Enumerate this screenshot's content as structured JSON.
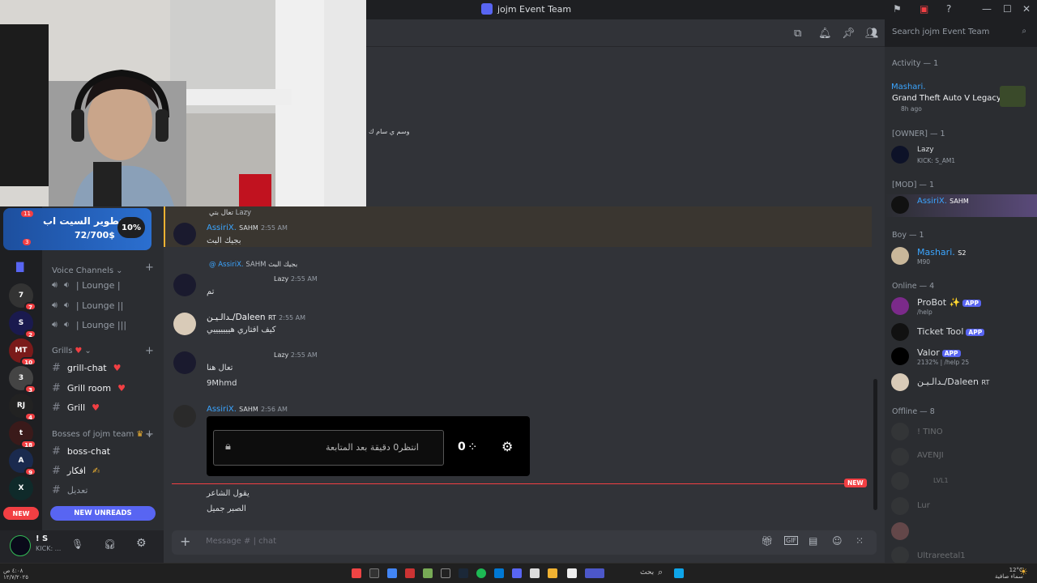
{
  "window": {
    "title": "jojm Event Team",
    "min": "—",
    "max": "☐",
    "close": "✕"
  },
  "banner": {
    "title": "تطوير السيت اب",
    "amount": "72/700$",
    "percent": "10%",
    "count": "11",
    "count2": "3"
  },
  "categories": [
    {
      "label": "Voice Channels",
      "channels": [
        "| Lounge |",
        "| Lounge ||",
        "| Lounge |||"
      ]
    },
    {
      "label": "Grills",
      "channels": [
        "grill-chat",
        "Grill room",
        "Grill"
      ]
    },
    {
      "label": "Bosses of jojm team",
      "channels": [
        "boss-chat",
        "افكار",
        "تعديل"
      ]
    }
  ],
  "servers": [
    {
      "abbr": "7",
      "badge": "7"
    },
    {
      "abbr": "S",
      "badge": "2"
    },
    {
      "abbr": "MT",
      "badge": "10"
    },
    {
      "abbr": "3",
      "badge": "3"
    },
    {
      "abbr": "RJ",
      "badge": "4"
    },
    {
      "abbr": "t",
      "badge": "18"
    },
    {
      "abbr": "A",
      "badge": "9"
    },
    {
      "abbr": "X",
      "badge": ""
    }
  ],
  "new_unreads": "NEW UNREADS",
  "new_pill": "NEW",
  "user": {
    "name": "! S",
    "status": "KICK: ..."
  },
  "search": {
    "placeholder": "Search jojm Event Team"
  },
  "overlay_text": "وسم ي سام ك",
  "messages": [
    {
      "reply": "تعال بتي",
      "reply_tag": "Lazy",
      "author": "AssiriX.",
      "tag": "SAHM",
      "time": "2:55 AM",
      "text": "بجيك البث"
    },
    {
      "reply": "بجيك البث",
      "reply_user": "@ AssiriX.",
      "reply_tag": "SAHM",
      "tag": "Lazy",
      "time": "2:55 AM",
      "text": "تم"
    },
    {
      "author": "ـدالـيـن/Daleen",
      "tag": "RT",
      "time": "2:55 AM",
      "text": "كيف افتاري هيييييييي"
    },
    {
      "tag": "Lazy",
      "time": "2:55 AM",
      "text": "تعال هنا",
      "text2": "9Mhmd"
    },
    {
      "author": "AssiriX.",
      "tag": "SAHM",
      "time": "2:56 AM"
    },
    {
      "text": "يقول الشاعر",
      "text2": "الصبر جميل"
    }
  ],
  "embed": {
    "text": "انتظر0 دقيقة بعد المتابعة",
    "count": "0"
  },
  "new_tag": "NEW",
  "composer": {
    "placeholder": "Message #",
    "channel": "| chat"
  },
  "members": {
    "activity": {
      "header": "Activity — 1",
      "name": "Mashari.",
      "game": "Grand Theft Auto V Legacy",
      "ago": "8h ago"
    },
    "owner": {
      "header": "[OWNER] — 1",
      "name": "Lazy",
      "sub": "KICK: S_AM1"
    },
    "mod": {
      "header": "[MOD] — 1",
      "name": "AssiriX.",
      "tag": "SAHM"
    },
    "boy": {
      "header": "Boy — 1",
      "name": "Mashari.",
      "tag": "S2",
      "sub": "M90"
    },
    "online": {
      "header": "Online — 4",
      "list": [
        {
          "name": "ProBot ✨",
          "app": "APP",
          "sub": "/help"
        },
        {
          "name": "Ticket Tool",
          "app": "APP",
          "sub": ""
        },
        {
          "name": "Valor",
          "app": "APP",
          "sub": "2132% | /help 25"
        },
        {
          "name": "ـدالـيـن/Daleen",
          "app": "RT",
          "sub": ""
        }
      ]
    },
    "offline": {
      "header": "Offline — 8",
      "list": [
        "! TINO",
        "AVENJI",
        "LVL1",
        "Lur",
        "",
        "Ultrareetal1"
      ]
    }
  },
  "taskbar": {
    "search": "بحث",
    "time": "٤:٠٨ ص",
    "date": "١٢/٧/٢٠٢٥",
    "weather": "12°C",
    "weather_sub": "سماء صافية"
  },
  "colors": {
    "accent": "#5865f2",
    "danger": "#f23f43",
    "link": "#3ba5ff",
    "highlight": "#f0b232"
  }
}
